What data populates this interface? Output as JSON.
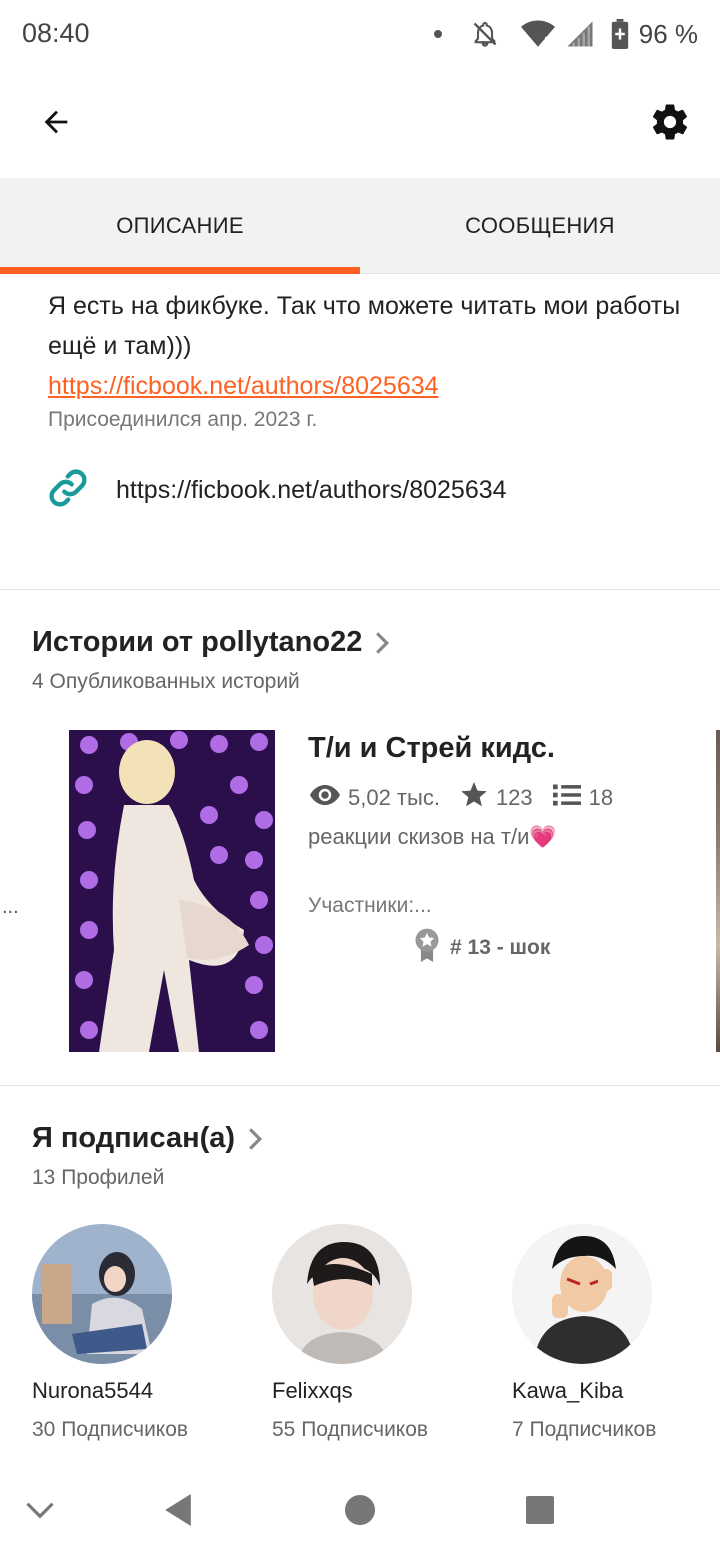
{
  "status_bar": {
    "time": "08:40",
    "battery": "96 %",
    "icons": [
      "dot-icon",
      "bell-off-icon",
      "wifi-icon",
      "signal-icon",
      "battery-icon"
    ]
  },
  "app_bar": {
    "back_icon": "arrow-left-icon",
    "settings_icon": "gear-icon"
  },
  "tabs": [
    {
      "label": "ОПИСАНИЕ",
      "active": true
    },
    {
      "label": "СООБЩЕНИЯ",
      "active": false
    }
  ],
  "about": {
    "description": "Я есть на фикбуке. Так что можете читать мои работы ещё и там)))",
    "link_text": "https://ficbook.net/authors/8025634",
    "joined": "Присоединился апр. 2023 г.",
    "website_icon": "link-icon",
    "website": "https://ficbook.net/authors/8025634"
  },
  "stories_section": {
    "title": "Истории от pollytano22",
    "subtitle": "4 Опубликованных историй",
    "left_ellipsis": "...",
    "story": {
      "title": "Т/и и Стрей кидс.",
      "views": "5,02 тыс.",
      "votes": "123",
      "parts": "18",
      "description": "реакции скизов на т/и💗",
      "cast": "Участники:...",
      "rank": "# 13 - шок"
    }
  },
  "following_section": {
    "title": "Я подписан(а)",
    "subtitle": "13 Профилей",
    "profiles": [
      {
        "name": "Nurona5544",
        "followers": "30 Подписчиков"
      },
      {
        "name": "Felixxqs",
        "followers": "55 Подписчиков"
      },
      {
        "name": "Kawa_Kiba",
        "followers": "7 Подписчиков"
      }
    ]
  },
  "nav_bar": {
    "icons": [
      "chevron-down-icon",
      "back-triangle-icon",
      "home-circle-icon",
      "recents-square-icon"
    ]
  },
  "colors": {
    "accent": "#ff6122",
    "link_icon": "#1a9a9a",
    "tab_background": "#f2f2f2"
  }
}
